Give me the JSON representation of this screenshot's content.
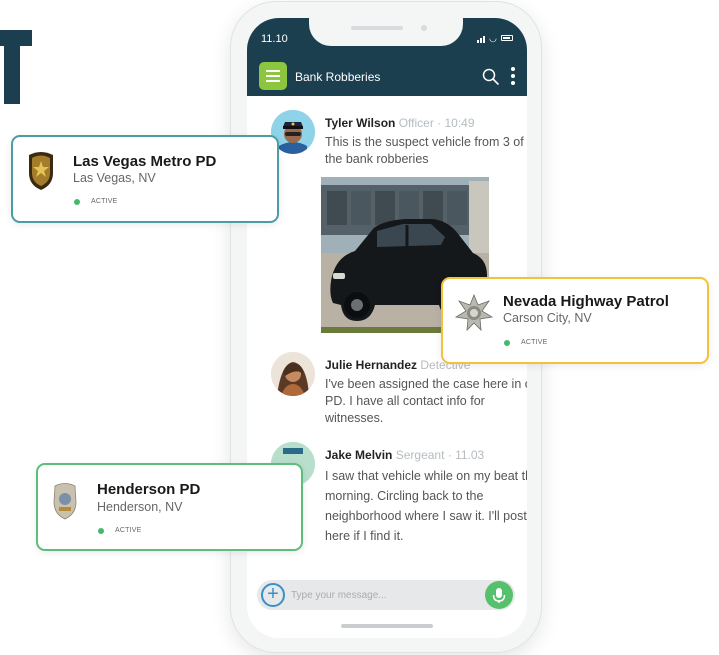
{
  "colors": {
    "navy": "#1c3f4f",
    "menu_green": "#8cc63f",
    "mic_green": "#56c16c",
    "plus_blue": "#3b8fc7",
    "active_green": "#46b86b",
    "card_border_lvmpd": "#4a9da6",
    "card_border_nhp": "#f3c23a",
    "card_border_henderson": "#5fbd7b"
  },
  "phone": {
    "status": {
      "time": "11.10"
    },
    "header": {
      "title": "Bank Robberies",
      "menu_icon": "hamburger-icon",
      "search_icon": "search-icon",
      "more_icon": "kebab-icon"
    },
    "messages": [
      {
        "name": "Tyler Wilson",
        "meta": "Officer · 10:49",
        "text": "This is the suspect vehicle from 3 of the bank robberies",
        "attachment": "photo of black sedan"
      },
      {
        "name": "Julie Hernandez",
        "meta": "Detective",
        "text": "I've been assigned the case here in our PD. I have all contact info for witnesses."
      },
      {
        "name": "Jake Melvin",
        "meta": "Sergeant · 11.03",
        "text": "I saw that vehicle while on my beat this morning. Circling back to the neighborhood where I saw it. I'll post here if I find it."
      }
    ],
    "composer": {
      "placeholder": "Type your message...",
      "add_icon": "plus-circle-icon",
      "mic_icon": "microphone-icon"
    }
  },
  "agencies": [
    {
      "name": "Las Vegas Metro PD",
      "location": "Las Vegas, NV",
      "status": "ACTIVE",
      "badge_icon": "police-star-badge-icon"
    },
    {
      "name": "Nevada Highway Patrol",
      "location": "Carson City, NV",
      "status": "ACTIVE",
      "badge_icon": "sheriff-star-badge-icon"
    },
    {
      "name": "Henderson PD",
      "location": "Henderson, NV",
      "status": "ACTIVE",
      "badge_icon": "police-shield-badge-icon"
    }
  ]
}
